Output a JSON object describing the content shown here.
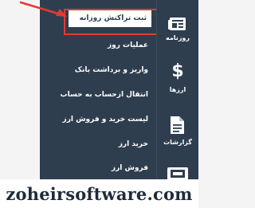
{
  "menu": {
    "items": [
      {
        "label": "ثبت تراکنش روزانه",
        "active": true
      },
      {
        "label": "عملیات روز",
        "active": false
      },
      {
        "label": "واریز و برداشت بانک",
        "active": false
      },
      {
        "label": "انتقال ازحساب به حساب",
        "active": false
      },
      {
        "label": "لیست خرید و فروش ارز",
        "active": false
      },
      {
        "label": "خرید ارز",
        "active": false
      },
      {
        "label": "فروش ارز",
        "active": false
      }
    ]
  },
  "sidebar": {
    "items": [
      {
        "label": "روزنامه",
        "icon": "newspaper-icon"
      },
      {
        "label": "ارزها",
        "icon": "dollar-icon"
      },
      {
        "label": "گزارشات",
        "icon": "document-icon"
      },
      {
        "label": "",
        "icon": "ticket-icon"
      }
    ]
  },
  "footer": {
    "text": "zoheirsoftware.com"
  },
  "colors": {
    "panel": "#2e3e4f",
    "highlight": "#e53935"
  }
}
